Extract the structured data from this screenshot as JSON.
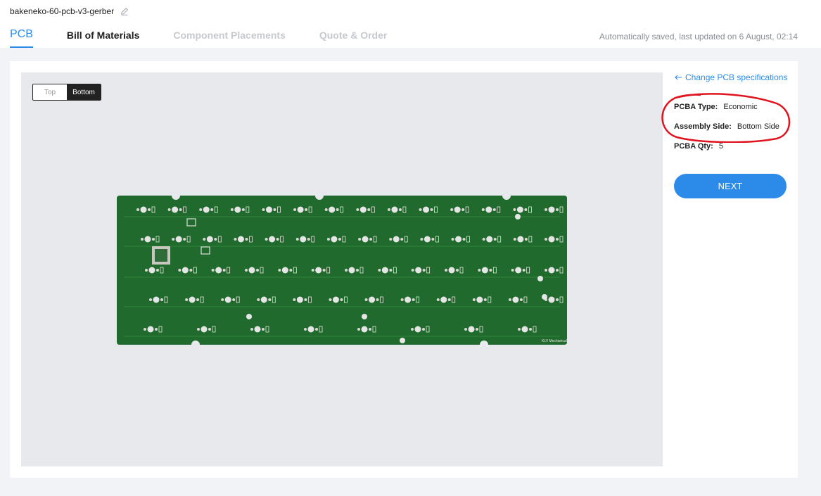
{
  "project": {
    "name": "bakeneko-60-pcb-v3-gerber",
    "edit_icon": "pencil-icon"
  },
  "tabs": [
    {
      "label": "PCB",
      "state": "active"
    },
    {
      "label": "Bill of Materials",
      "state": "normal"
    },
    {
      "label": "Component Placements",
      "state": "disabled"
    },
    {
      "label": "Quote & Order",
      "state": "disabled"
    }
  ],
  "saved_status": "Automatically saved, last updated on 6 August, 02:14",
  "viewer": {
    "toggle": {
      "top": "Top",
      "bottom": "Bottom",
      "selected": "Bottom"
    },
    "board_text": "KLV Mechanical"
  },
  "side": {
    "change_link": "Change PCB specifications",
    "change_icon": "arrow-left-icon",
    "specs": [
      {
        "label": "PCBA Type:",
        "value": "Economic"
      },
      {
        "label": "Assembly Side:",
        "value": "Bottom Side"
      },
      {
        "label": "PCBA Qty:",
        "value": "5"
      }
    ],
    "next_label": "NEXT"
  },
  "colors": {
    "accent": "#2c8ae8",
    "pcb_green": "#1f6a2c",
    "annotation_red": "#e0141e"
  }
}
